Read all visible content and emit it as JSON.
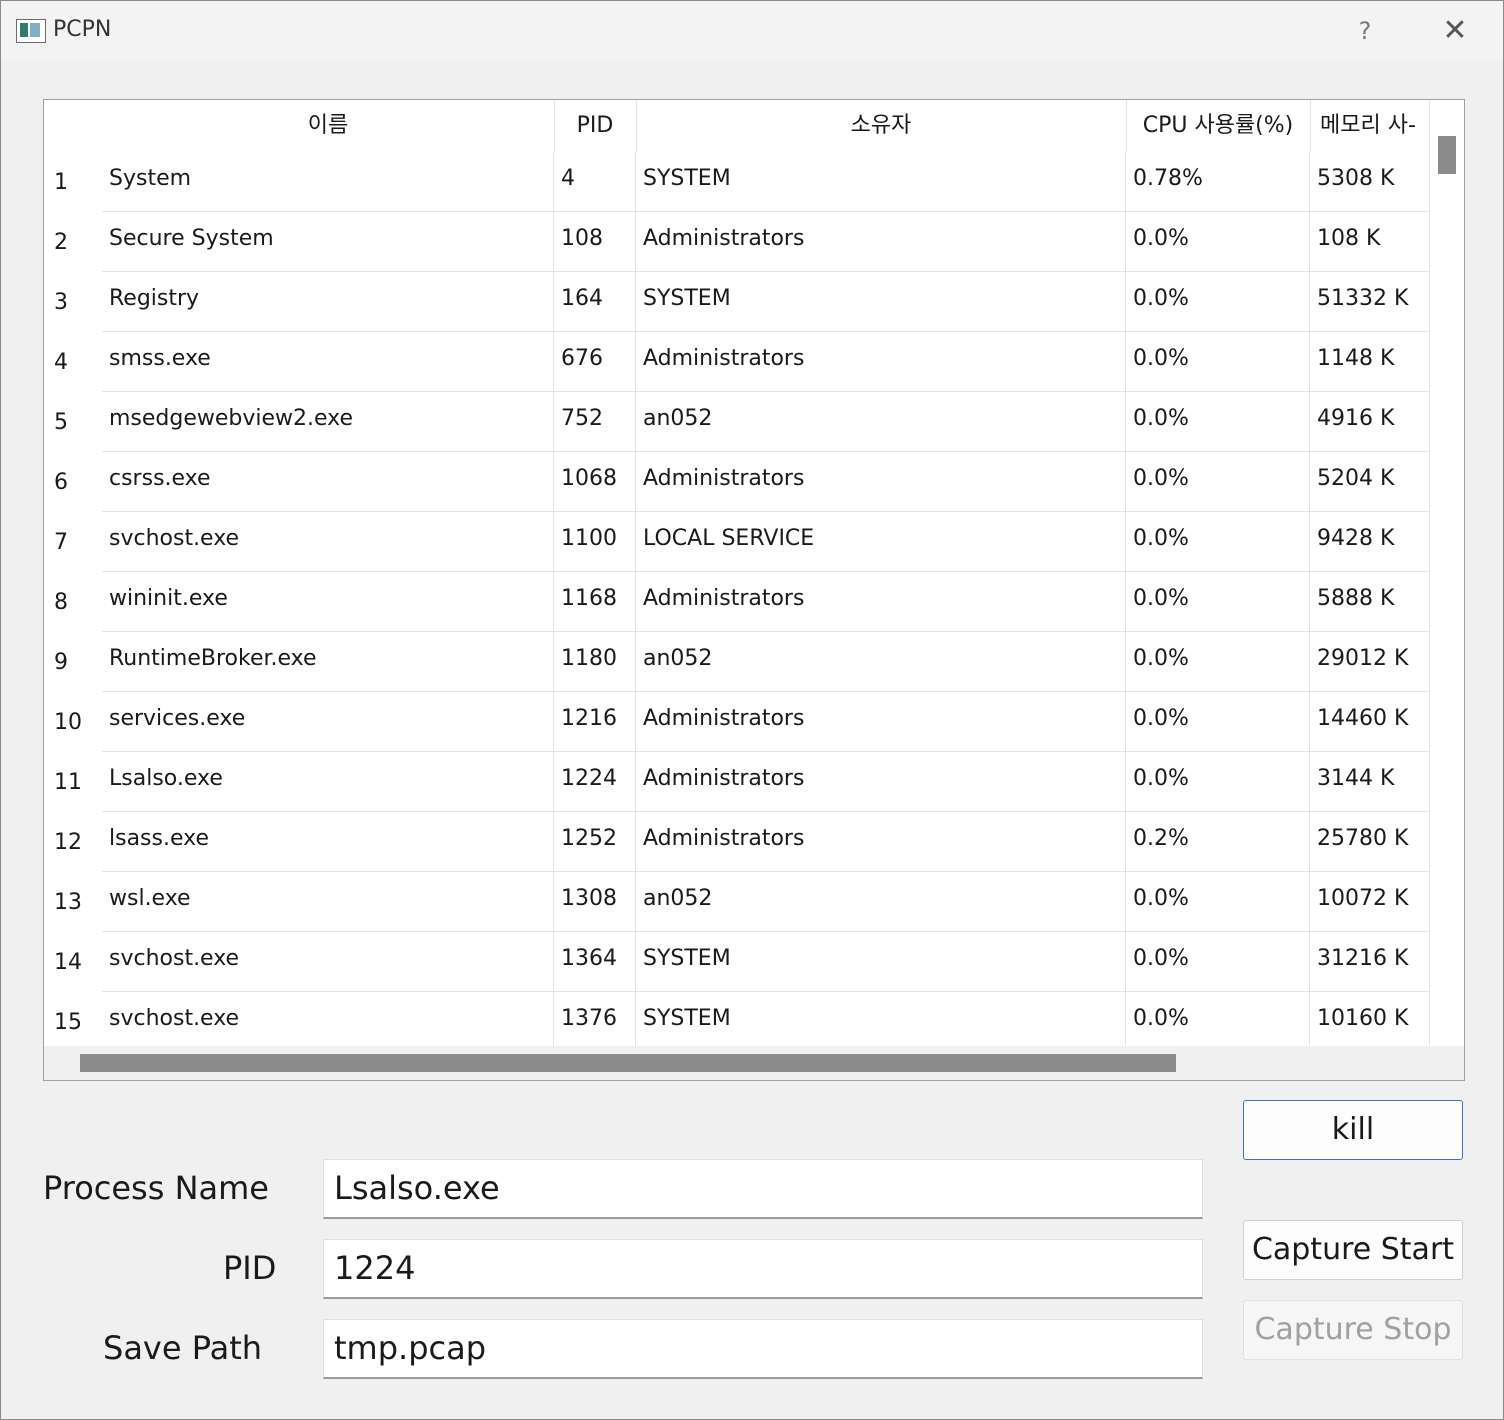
{
  "window": {
    "title": "PCPN",
    "help": "?",
    "close": "✕"
  },
  "table": {
    "columns": [
      "이름",
      "PID",
      "소유자",
      "CPU 사용률(%)",
      "메모리 사-"
    ],
    "rows": [
      {
        "num": "1",
        "name": "System",
        "pid": "4",
        "owner": "SYSTEM",
        "cpu": "0.78%",
        "mem": "5308 K"
      },
      {
        "num": "2",
        "name": "Secure System",
        "pid": "108",
        "owner": "Administrators",
        "cpu": "0.0%",
        "mem": "108 K"
      },
      {
        "num": "3",
        "name": "Registry",
        "pid": "164",
        "owner": "SYSTEM",
        "cpu": "0.0%",
        "mem": "51332 K"
      },
      {
        "num": "4",
        "name": "smss.exe",
        "pid": "676",
        "owner": "Administrators",
        "cpu": "0.0%",
        "mem": "1148 K"
      },
      {
        "num": "5",
        "name": "msedgewebview2.exe",
        "pid": "752",
        "owner": "an052",
        "cpu": "0.0%",
        "mem": "4916 K"
      },
      {
        "num": "6",
        "name": "csrss.exe",
        "pid": "1068",
        "owner": "Administrators",
        "cpu": "0.0%",
        "mem": "5204 K"
      },
      {
        "num": "7",
        "name": "svchost.exe",
        "pid": "1100",
        "owner": "LOCAL SERVICE",
        "cpu": "0.0%",
        "mem": "9428 K"
      },
      {
        "num": "8",
        "name": "wininit.exe",
        "pid": "1168",
        "owner": "Administrators",
        "cpu": "0.0%",
        "mem": "5888 K"
      },
      {
        "num": "9",
        "name": "RuntimeBroker.exe",
        "pid": "1180",
        "owner": "an052",
        "cpu": "0.0%",
        "mem": "29012 K"
      },
      {
        "num": "10",
        "name": "services.exe",
        "pid": "1216",
        "owner": "Administrators",
        "cpu": "0.0%",
        "mem": "14460 K"
      },
      {
        "num": "11",
        "name": "Lsalso.exe",
        "pid": "1224",
        "owner": "Administrators",
        "cpu": "0.0%",
        "mem": "3144 K"
      },
      {
        "num": "12",
        "name": "lsass.exe",
        "pid": "1252",
        "owner": "Administrators",
        "cpu": "0.2%",
        "mem": "25780 K"
      },
      {
        "num": "13",
        "name": "wsl.exe",
        "pid": "1308",
        "owner": "an052",
        "cpu": "0.0%",
        "mem": "10072 K"
      },
      {
        "num": "14",
        "name": "svchost.exe",
        "pid": "1364",
        "owner": "SYSTEM",
        "cpu": "0.0%",
        "mem": "31216 K"
      },
      {
        "num": "15",
        "name": "svchost.exe",
        "pid": "1376",
        "owner": "SYSTEM",
        "cpu": "0.0%",
        "mem": "10160 K"
      }
    ]
  },
  "buttons": {
    "kill": "kill",
    "capture_start": "Capture Start",
    "capture_stop": "Capture Stop"
  },
  "form": {
    "process_name_label": "Process Name",
    "process_name_value": "Lsalso.exe",
    "pid_label": "PID",
    "pid_value": "1224",
    "save_path_label": "Save Path",
    "save_path_value": "tmp.pcap"
  }
}
